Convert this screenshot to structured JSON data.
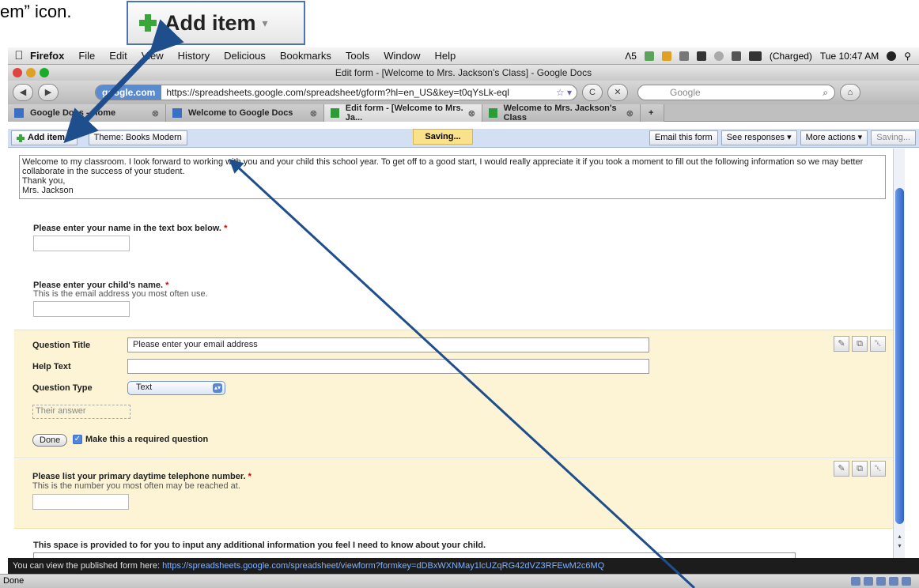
{
  "callout": {
    "caption": "em” icon.",
    "button_label": "Add item",
    "caret": "▾"
  },
  "menubar": {
    "apple": "",
    "app_name": "Firefox",
    "items": [
      "File",
      "Edit",
      "View",
      "History",
      "Delicious",
      "Bookmarks",
      "Tools",
      "Window",
      "Help"
    ],
    "status_text": "Λ5",
    "battery": "(Charged)",
    "clock": "Tue 10:47 AM",
    "spotlight_icon": "search-icon"
  },
  "window": {
    "title": "Edit form - [Welcome to Mrs. Jackson's Class] - Google Docs"
  },
  "navbar": {
    "back": "◀",
    "forward": "▶",
    "site_badge": "google.com",
    "url": "https://spreadsheets.google.com/spreadsheet/gform?hl=en_US&key=t0qYsLk-eql",
    "star": "☆ ▾",
    "reload": "C",
    "stop": "✕",
    "search_placeholder": "Google",
    "search_icon": "⌕",
    "home": "⌂"
  },
  "tabs": [
    {
      "label": "Google Docs - Home",
      "active": false
    },
    {
      "label": "Welcome to Google Docs",
      "active": false
    },
    {
      "label": "Edit form - [Welcome to Mrs. Ja...",
      "active": true
    },
    {
      "label": "Welcome to Mrs. Jackson's Class",
      "active": false
    }
  ],
  "tab_close": "⊗",
  "tab_new": "+",
  "gtoolbar": {
    "add_item": "Add item",
    "add_caret": "▾",
    "theme": "Theme: Books Modern",
    "saving_pill": "Saving...",
    "email": "Email this form",
    "responses": "See responses ▾",
    "more": "More actions ▾",
    "saving_btn": "Saving..."
  },
  "form": {
    "intro_lines": [
      "Welcome to my classroom. I look forward to working with you and your child this school year. To get off to a good start, I would really appreciate it if you took a moment to fill out the following information so we may better",
      "collaborate in the success of your student.",
      "Thank you,",
      "Mrs. Jackson"
    ],
    "q1": {
      "title": "Please enter your name in the text box below.",
      "required_mark": "*"
    },
    "q2": {
      "title": "Please enter your child's name.",
      "required_mark": "*",
      "help": "This is the email address you most often use."
    },
    "edit": {
      "title_label": "Question Title",
      "title_value": "Please enter your email address",
      "help_label": "Help Text",
      "help_value": "",
      "type_label": "Question Type",
      "type_value": "Text",
      "type_arrow": "▴▾",
      "answer_placeholder": "Their answer",
      "done": "Done",
      "check": "✓",
      "required_label": "Make this a required question"
    },
    "q4": {
      "title": "Please list your primary daytime telephone number.",
      "required_mark": "*",
      "help": "This is the number you most often may be reached at."
    },
    "q5": {
      "title": "This space is provided to for you to input any additional information you feel I need to know about your child."
    },
    "tool_icons": {
      "edit": "✎",
      "duplicate": "⧉",
      "delete": "␡"
    }
  },
  "scroll": {
    "up": "▴",
    "down": "▾"
  },
  "published": {
    "text": "You can view the published form here: ",
    "link": "https://spreadsheets.google.com/spreadsheet/viewform?formkey=dDBxWXNMay1lcUZqRG42dVZ3RFEwM2c6MQ"
  },
  "status": {
    "text": "Done"
  },
  "colors": {
    "accent": "#1f4e8c",
    "callout_border": "#4a74b8",
    "edit_bg": "#fdf4d6"
  }
}
